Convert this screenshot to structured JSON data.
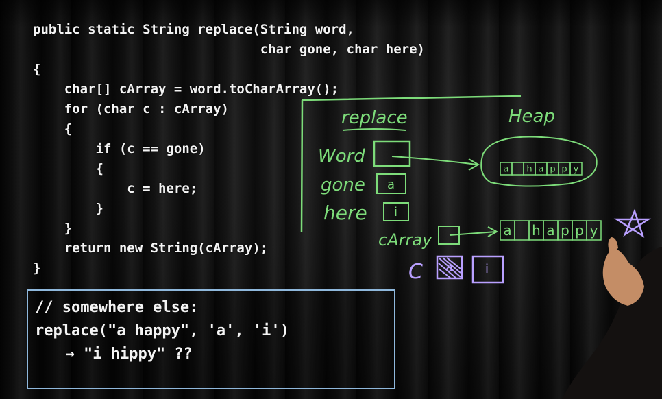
{
  "code_lines": [
    "public static String replace(String word,",
    "                             char gone, char here)",
    "{",
    "    char[] cArray = word.toCharArray();",
    "    for (char c : cArray)",
    "    {",
    "        if (c == gone)",
    "        {",
    "            c = here;",
    "        }",
    "    }",
    "    return new String(cArray);",
    "}"
  ],
  "snippet_lines": [
    "// somewhere else:",
    "replace(\"a happy\", 'a', 'i')",
    "  → \"i hippy\" ??"
  ],
  "diagram": {
    "frame_title": "replace",
    "heap_label": "Heap",
    "variables": {
      "word": "Word",
      "gone": "gone",
      "here": "here",
      "carray": "cArray",
      "c": "C"
    },
    "gone_value": "a",
    "here_value": "i",
    "c_old_value": "a",
    "c_new_value": "i",
    "heap_array": [
      "a",
      " ",
      "h",
      "a",
      "p",
      "p",
      "y"
    ],
    "carray_array": [
      "a",
      " ",
      "h",
      "a",
      "p",
      "p",
      "y"
    ],
    "ink_color": "#7ddc7a",
    "purple_color": "#b9a0ff"
  }
}
